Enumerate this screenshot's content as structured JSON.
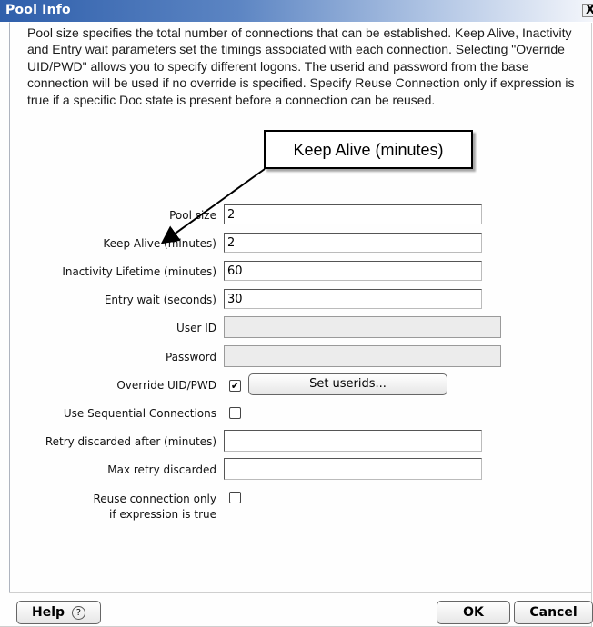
{
  "window": {
    "title": "Pool Info",
    "close_label": "X"
  },
  "description": "Pool size specifies the total number of connections that can be established.  Keep Alive, Inactivity and Entry wait parameters set the timings associated with each connection.  Selecting \"Override UID/PWD\" allows you to specify different logons. The userid and password from the base connection will be used if no override is specified. Specify Reuse Connection only if expression is true if a specific Doc state is present before a connection can be reused.",
  "callout": {
    "text": "Keep Alive (minutes)"
  },
  "form": {
    "pool_size": {
      "label": "Pool size",
      "value": "2"
    },
    "keep_alive": {
      "label": "Keep Alive (minutes)",
      "value": "2"
    },
    "inactivity": {
      "label": "Inactivity Lifetime (minutes)",
      "value": "60"
    },
    "entry_wait": {
      "label": "Entry wait (seconds)",
      "value": "30"
    },
    "user_id": {
      "label": "User ID",
      "value": ""
    },
    "password": {
      "label": "Password",
      "value": ""
    },
    "override": {
      "label": "Override UID/PWD",
      "checked": true,
      "check_glyph": "✔",
      "button_label": "Set userids..."
    },
    "sequential": {
      "label": "Use Sequential Connections",
      "checked": false
    },
    "retry_after": {
      "label": "Retry discarded after (minutes)",
      "value": ""
    },
    "max_retry": {
      "label": "Max retry discarded",
      "value": ""
    },
    "reuse": {
      "label_line1": "Reuse connection only",
      "label_line2": "if expression is true",
      "checked": false
    }
  },
  "footer": {
    "help_label": "Help",
    "help_icon": "?",
    "ok_label": "OK",
    "cancel_label": "Cancel"
  },
  "colors": {
    "title_gradient_start": "#2f5fab",
    "title_gradient_end": "#f4f6fb",
    "disabled_field": "#ececec"
  }
}
